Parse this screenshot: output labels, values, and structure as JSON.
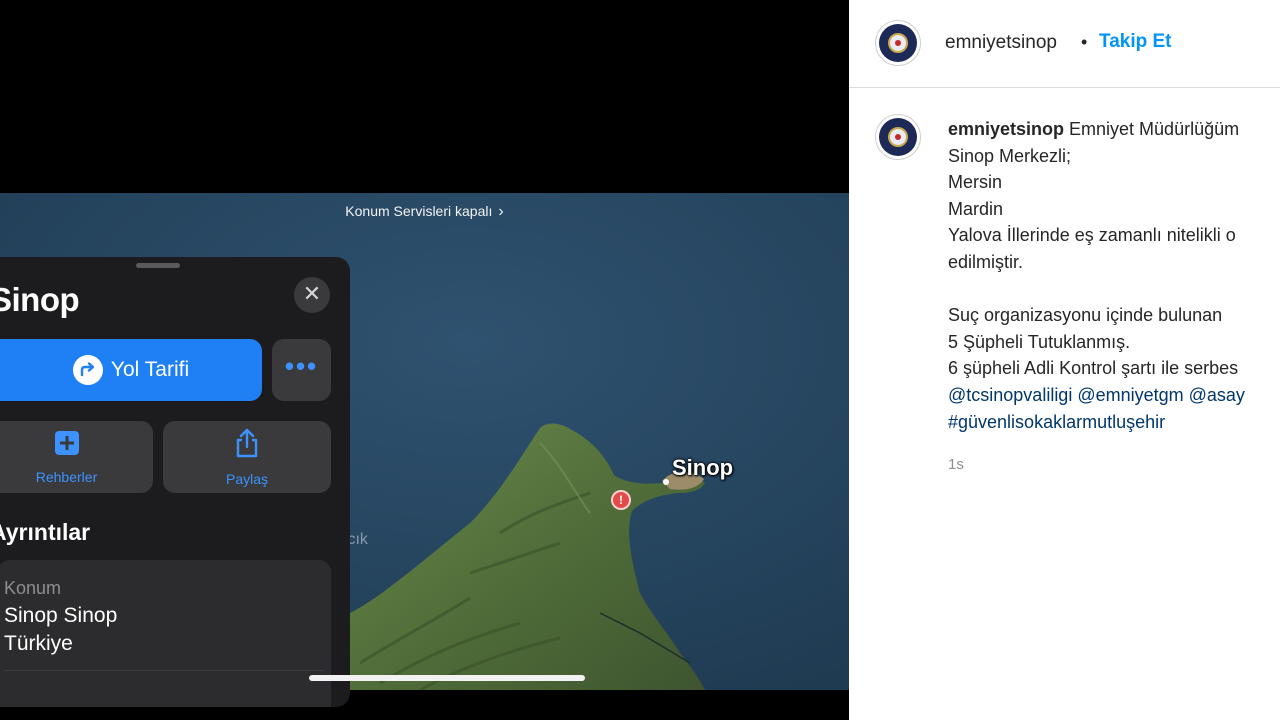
{
  "map": {
    "location_services_label": "Konum Servisleri kapalı",
    "location_services_chevron": "›",
    "city_label": "Sinop",
    "faded_label": "ıcık",
    "pin_glyph": "!"
  },
  "place_card": {
    "title": "Sinop",
    "close_glyph": "✕",
    "directions_label": "Yol Tarifi",
    "more_glyph": "•••",
    "guides_label": "Rehberler",
    "share_label": "Paylaş",
    "details_title": "Ayrıntılar",
    "location": {
      "key": "Konum",
      "line1": "Sinop Sinop",
      "line2": "Türkiye"
    }
  },
  "instagram": {
    "username": "emniyetsinop",
    "separator": "•",
    "follow_label": "Takip Et",
    "caption_user": "emniyetsinop",
    "caption_first": " Emniyet Müdürlüğüm",
    "caption_lines": [
      "Sinop Merkezli;",
      "Mersin",
      "Mardin",
      "Yalova İllerinde eş zamanlı nitelikli o",
      "edilmiştir."
    ],
    "caption_lines2": [
      "Suç organizasyonu içinde bulunan",
      "5 Şüpheli Tutuklanmış.",
      "6 şüpheli Adli Kontrol şartı ile serbes"
    ],
    "mentions": "@tcsinopvaliligi @emniyetgm @asay",
    "hashtag": "#güvenlisokaklarmutluşehir",
    "timestamp": "1s"
  },
  "colors": {
    "sea": "#2a4a63",
    "land": "#5d7a43",
    "accent_blue": "#1f7ff5",
    "link_blue": "#0095f6"
  }
}
